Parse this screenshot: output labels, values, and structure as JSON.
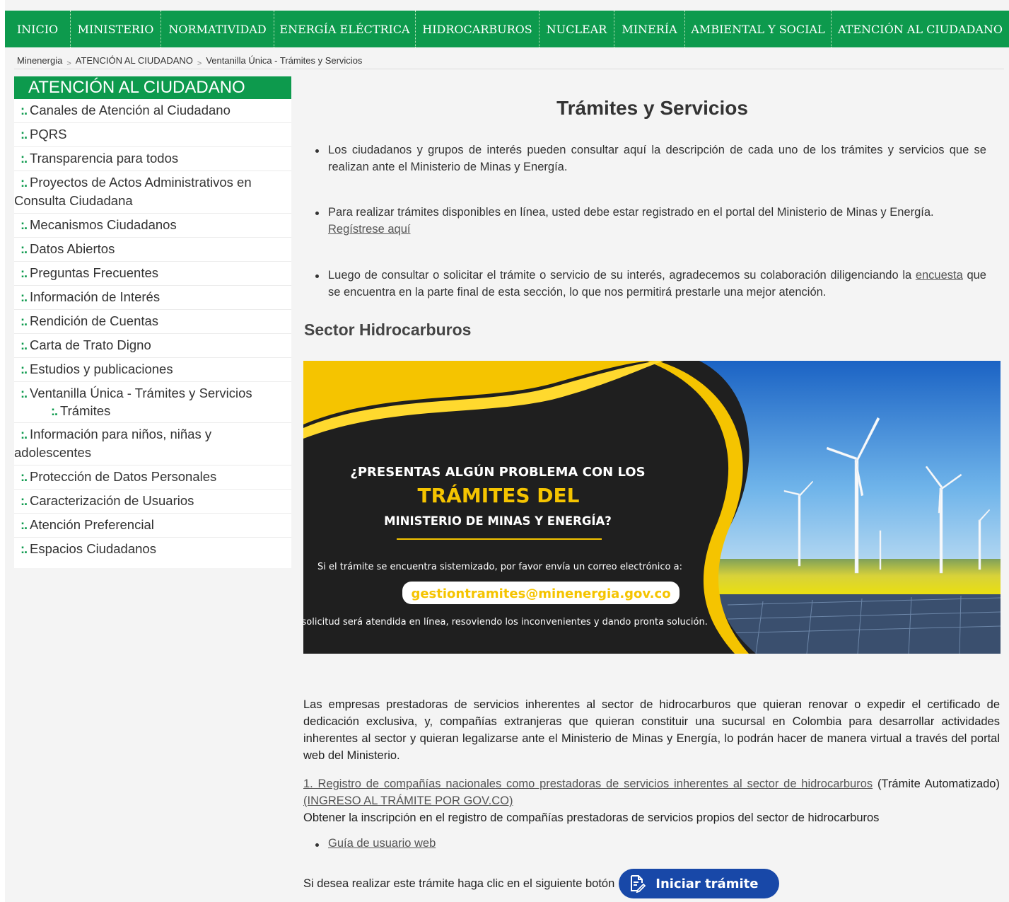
{
  "nav": {
    "items": [
      "INICIO",
      "MINISTERIO",
      "NORMATIVIDAD",
      "ENERGÍA ELÉCTRICA",
      "HIDROCARBUROS",
      "NUCLEAR",
      "MINERÍA",
      "AMBIENTAL Y SOCIAL",
      "ATENCIÓN AL CIUDADANO"
    ]
  },
  "breadcrumb": {
    "home": "Minenergia",
    "section": "ATENCIÓN AL CIUDADANO",
    "current": "Ventanilla Única - Trámites y Servicios",
    "separator": ">"
  },
  "sidebar": {
    "heading": "ATENCIÓN AL CIUDADANO",
    "bullet": ":.",
    "items": [
      "Canales de Atención al Ciudadano",
      "PQRS",
      "Transparencia para todos",
      "Proyectos de Actos Administrativos en Consulta Ciudadana",
      "Mecanismos Ciudadanos",
      "Datos Abiertos",
      "Preguntas Frecuentes",
      "Información de Interés",
      "Rendición de Cuentas",
      "Carta de Trato Digno",
      "Estudios y publicaciones",
      "Ventanilla Única - Trámites y Servicios",
      "Información para niños, niñas y adolescentes",
      "Protección de Datos Personales",
      "Caracterización de Usuarios",
      "Atención Preferencial",
      "Espacios Ciudadanos"
    ],
    "subitem": "Trámites"
  },
  "main": {
    "title": "Trámites y Servicios",
    "bullet1": "Los ciudadanos y grupos de interés pueden consultar aquí la descripción de cada uno de los trámites y servicios que se realizan ante el Ministerio de Minas y Energía.",
    "bullet2_text": "Para realizar trámites disponibles en línea, usted debe estar registrado en el portal del Ministerio de Minas y Energía.",
    "bullet2_link": "Regístrese aquí",
    "bullet3_pre": "Luego de consultar o solicitar el trámite o servicio de su interés, agradecemos su colaboración diligenciando la",
    "bullet3_link": "encuesta",
    "bullet3_post": "que se encuentra en la parte final de esta sección, lo que nos permitirá prestarle una mejor atención.",
    "sector_title": "Sector Hidrocarburos",
    "banner": {
      "line1": "¿PRESENTAS ALGÚN PROBLEMA CON LOS",
      "line2": "TRÁMITES DEL",
      "line3": "MINISTERIO DE MINAS Y ENERGÍA?",
      "line4": "Si el trámite se encuentra sistemizado, por favor envía un correo electrónico a:",
      "email": "gestiontramites@minenergia.gov.co",
      "line5": "La solicitud será atendida en línea, resoviendo los inconvenientes y dando pronta solución."
    },
    "paragraph1": "Las empresas prestadoras de servicios inherentes al sector de hidrocarburos que quieran renovar o expedir el certificado de dedicación exclusiva, y, compañías extranjeras que quieran constituir una sucursal en Colombia para desarrollar actividades inherentes al sector y quieran legalizarse ante el Ministerio de Minas y Energía, lo podrán hacer de manera virtual a través del portal web del Ministerio.",
    "item1_link": "1. Registro de compañías nacionales como prestadoras de servicios inherentes al sector de hidrocarburos",
    "item1_note": "(Trámite Automatizado)",
    "item1_gov_link": "(INGRESO AL TRÁMITE POR GOV.CO)",
    "item1_desc": "Obtener la inscripción en el registro de compañías prestadoras de servicios propios del sector de hidrocarburos",
    "guide_link": "Guía de usuario web",
    "start_text": "Si desea realizar este trámite haga clic en el siguiente botón",
    "start_button": "Iniciar trámite"
  },
  "colors": {
    "brand_green": "#0d9a4d",
    "banner_yellow": "#f5c400",
    "button_blue": "#1848a8"
  }
}
